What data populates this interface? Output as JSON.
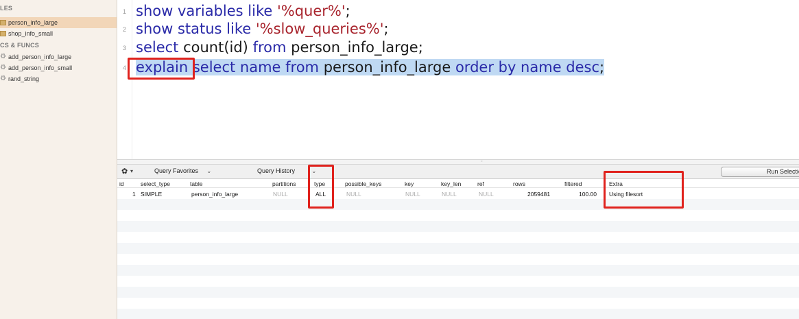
{
  "sidebar": {
    "tables_header": "LES",
    "tables": [
      "person_info_large",
      "shop_info_small"
    ],
    "procs_header": "CS & FUNCS",
    "procs": [
      "add_person_info_large",
      "add_person_info_small",
      "rand_string"
    ]
  },
  "editor": {
    "lines": [
      {
        "num": "1",
        "parts": [
          {
            "t": "show variables like ",
            "c": "kw"
          },
          {
            "t": "'%quer%'",
            "c": "str"
          },
          {
            "t": ";",
            "c": ""
          }
        ]
      },
      {
        "num": "2",
        "parts": [
          {
            "t": "show status like ",
            "c": "kw"
          },
          {
            "t": "'%slow_queries%'",
            "c": "str"
          },
          {
            "t": ";",
            "c": ""
          }
        ]
      },
      {
        "num": "3",
        "parts": [
          {
            "t": "select ",
            "c": "kw"
          },
          {
            "t": "count(id) ",
            "c": ""
          },
          {
            "t": "from ",
            "c": "kw"
          },
          {
            "t": "person_info_large;",
            "c": ""
          }
        ]
      },
      {
        "num": "4",
        "parts": [
          {
            "t": "explain",
            "c": "kw"
          },
          {
            "t": " select name ",
            "c": "kw"
          },
          {
            "t": "from ",
            "c": "kw"
          },
          {
            "t": "person_info_large ",
            "c": ""
          },
          {
            "t": "order by name desc",
            "c": "kw"
          },
          {
            "t": ";",
            "c": ""
          }
        ]
      }
    ]
  },
  "toolbar": {
    "gear": "✿",
    "query_favorites": "Query Favorites",
    "query_history": "Query History",
    "run_selection": "Run Selection"
  },
  "results": {
    "columns": [
      "id",
      "select_type",
      "table",
      "partitions",
      "type",
      "possible_keys",
      "key",
      "key_len",
      "ref",
      "rows",
      "filtered",
      "Extra"
    ],
    "rows": [
      [
        "1",
        "SIMPLE",
        "person_info_large",
        "NULL",
        "ALL",
        "NULL",
        "NULL",
        "NULL",
        "NULL",
        "2059481",
        "100.00",
        "Using filesort"
      ]
    ]
  },
  "colors": {
    "highlight": "#bfd9f3",
    "keyword": "#2a2aa8",
    "string": "#a8242d",
    "annotation_red": "#e0221d"
  }
}
